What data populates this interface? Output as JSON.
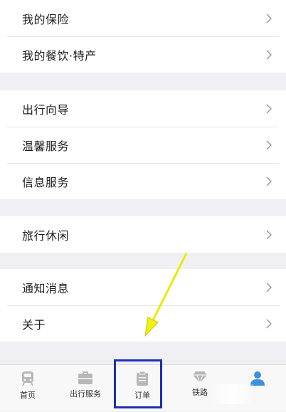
{
  "groups": [
    {
      "items": [
        {
          "label": "我的保险"
        },
        {
          "label": "我的餐饮·特产"
        }
      ]
    },
    {
      "items": [
        {
          "label": "出行向导"
        },
        {
          "label": "温馨服务"
        },
        {
          "label": "信息服务"
        }
      ]
    },
    {
      "items": [
        {
          "label": "旅行休闲"
        }
      ]
    },
    {
      "items": [
        {
          "label": "通知消息"
        },
        {
          "label": "关于"
        }
      ]
    }
  ],
  "tabbar": {
    "tabs": [
      {
        "label": "首页",
        "icon": "train-icon"
      },
      {
        "label": "出行服务",
        "icon": "briefcase-icon"
      },
      {
        "label": "订单",
        "icon": "clipboard-icon"
      },
      {
        "label": "铁路",
        "icon": "diamond-icon"
      },
      {
        "label": "",
        "icon": "person-icon"
      }
    ],
    "active_color": "#3d8fe0",
    "inactive_color": "#b7b7b7"
  },
  "annotation": {
    "arrow_color": "#f2f20c",
    "highlight_color": "#1e2fb0"
  }
}
